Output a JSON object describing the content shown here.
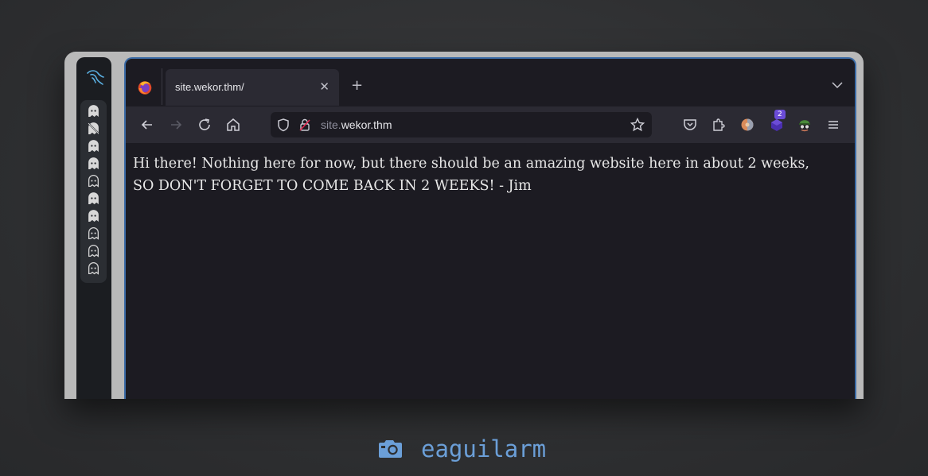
{
  "browser": {
    "tab": {
      "title": "site.wekor.thm/",
      "close_glyph": "✕"
    },
    "new_tab_glyph": "+",
    "url": {
      "subdomain": "site.",
      "host": "wekor.thm"
    },
    "extension_badge": "2"
  },
  "page": {
    "line1": "Hi there! Nothing here for now, but there should be an amazing website here in about 2 weeks,",
    "line2": "SO DON'T FORGET TO COME BACK IN 2 WEEKS! - Jim"
  },
  "caption": {
    "icon": "camera-icon",
    "text": "eaguilarm"
  },
  "colors": {
    "accent": "#3a6aa5",
    "caption": "#6b9fd8",
    "badge": "#6b4cd6"
  }
}
